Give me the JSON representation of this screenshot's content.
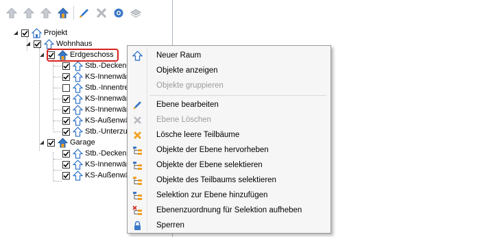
{
  "toolbar": {
    "buttons": [
      "layer-up-icon",
      "move-up-icon",
      "move-up-alt-icon",
      "home-layer-icon",
      "edit-pen-icon",
      "delete-x-icon",
      "settings-eye-icon",
      "layers-stack-icon"
    ]
  },
  "tree": {
    "projekt": "Projekt",
    "wohnhaus": "Wohnhaus",
    "erdgeschoss": "Erdgeschoss",
    "eg_children": [
      {
        "label": "Stb.-Deckenp",
        "checked": true
      },
      {
        "label": "KS-Innenwän",
        "checked": true
      },
      {
        "label": "Stb.-Innentrep",
        "checked": false
      },
      {
        "label": "KS-Innenwän",
        "checked": true
      },
      {
        "label": "KS-Innenwän",
        "checked": true
      },
      {
        "label": "KS-Außenwär",
        "checked": true
      },
      {
        "label": "Stb.-Unterzug",
        "checked": true
      }
    ],
    "garage": "Garage",
    "garage_children": [
      {
        "label": "Stb.-Deckenp",
        "checked": true
      },
      {
        "label": "KS-Innenwän",
        "checked": true
      },
      {
        "label": "KS-Außenwär",
        "checked": true
      }
    ]
  },
  "menu": {
    "items": [
      {
        "label": "Neuer Raum",
        "icon": "house-arrow-icon",
        "enabled": true
      },
      {
        "label": "Objekte anzeigen",
        "icon": "",
        "enabled": true
      },
      {
        "label": "Objekte gruppieren",
        "icon": "",
        "enabled": false
      },
      {
        "label": "Ebene bearbeiten",
        "icon": "pen-icon",
        "enabled": true
      },
      {
        "label": "Ebene Löschen",
        "icon": "gray-x-icon",
        "enabled": false
      },
      {
        "label": "Lösche leere Teilbäume",
        "icon": "orange-x-icon",
        "enabled": true
      },
      {
        "label": "Objekte der Ebene hervorheben",
        "icon": "tree-highlight-icon",
        "enabled": true
      },
      {
        "label": "Objekte der Ebene selektieren",
        "icon": "tree-select-icon",
        "enabled": true
      },
      {
        "label": "Objekte des Teilbaums selektieren",
        "icon": "subtree-select-icon",
        "enabled": true
      },
      {
        "label": "Selektion zur Ebene hinzufügen",
        "icon": "tree-add-icon",
        "enabled": true
      },
      {
        "label": "Ebenenzuordnung für Selektion aufheben",
        "icon": "tree-remove-icon",
        "enabled": true
      },
      {
        "label": "Sperren",
        "icon": "lock-icon",
        "enabled": true
      }
    ]
  },
  "colors": {
    "accent_blue": "#3a78c8",
    "house_orange": "#f0a020",
    "highlight_red": "#d8231e",
    "disabled_text": "#9b9b9b"
  }
}
